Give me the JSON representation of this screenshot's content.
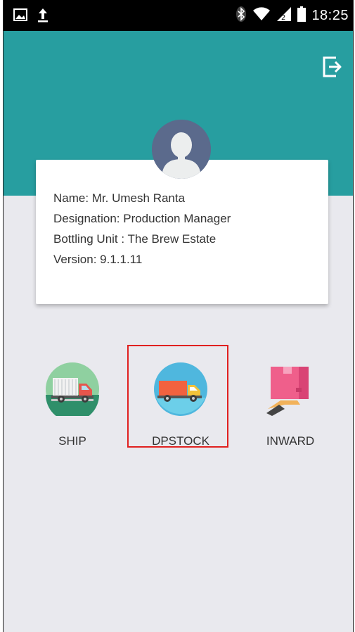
{
  "status_bar": {
    "time": "18:25",
    "left_icons": [
      "image-icon",
      "upload-icon"
    ],
    "right_icons": [
      "bluetooth-icon",
      "wifi-icon",
      "signal-icon",
      "battery-icon"
    ]
  },
  "header": {
    "color": "#279ea0",
    "logout_icon": "logout-icon"
  },
  "profile": {
    "name": "Name: Mr. Umesh Ranta",
    "designation": "Designation: Production Manager",
    "bottling_unit": "Bottling Unit : The Brew Estate",
    "version": "Version: 9.1.1.11"
  },
  "menu": {
    "items": [
      {
        "label": "SHIP",
        "icon": "ship-truck-icon"
      },
      {
        "label": "DPSTOCK",
        "icon": "delivery-truck-icon"
      },
      {
        "label": "INWARD",
        "icon": "inward-box-icon"
      }
    ]
  },
  "highlight_color": "#e0201f"
}
